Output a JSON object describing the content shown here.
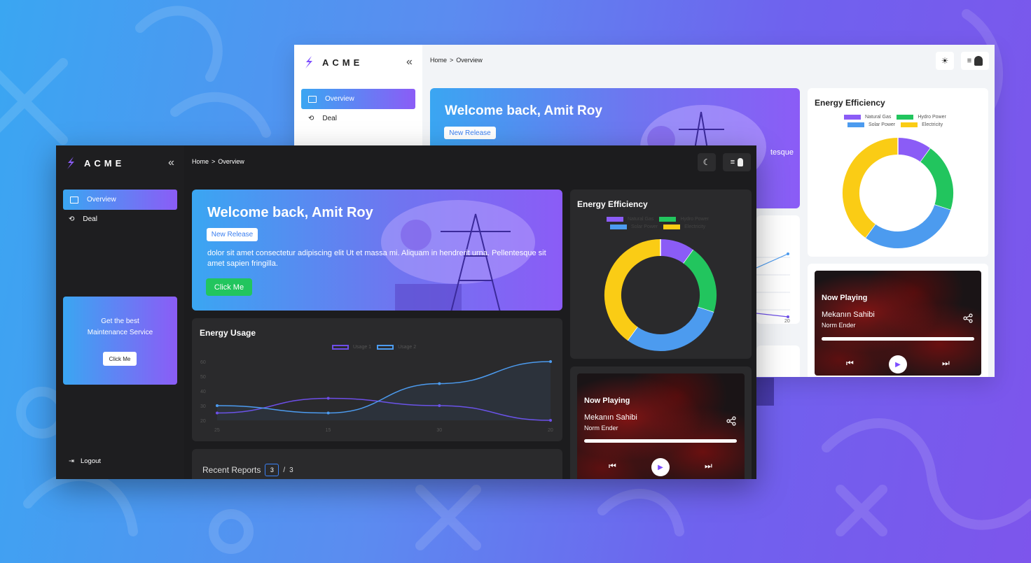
{
  "brand": {
    "name": "ACME"
  },
  "nav": {
    "items": [
      {
        "label": "Overview",
        "icon": "overview-icon",
        "active": true
      },
      {
        "label": "Deal",
        "icon": "deal-icon",
        "active": false
      }
    ],
    "collapse_glyph": "«",
    "logout_label": "Logout"
  },
  "breadcrumb": {
    "home": "Home",
    "separator": ">",
    "current": "Overview"
  },
  "hero": {
    "title": "Welcome back, Amit Roy",
    "badge": "New Release",
    "body": "dolor sit amet consectetur adipiscing elit Ut et massa mi. Aliquam in hendrerit urna. Pellentesque sit amet sapien fringilla.",
    "cta": "Click Me",
    "partial_text_light": "tesque"
  },
  "promo": {
    "line1": "Get the best",
    "line2": "Maintenance Service",
    "cta": "Click Me"
  },
  "energy_efficiency": {
    "title": "Energy Efficiency",
    "legend": [
      {
        "label": "Natural Gas",
        "color": "#8b5cf6"
      },
      {
        "label": "Hydro Power",
        "color": "#22c55e"
      },
      {
        "label": "Solar Power",
        "color": "#4c9bef"
      },
      {
        "label": "Electricity",
        "color": "#facc15"
      }
    ]
  },
  "energy_usage": {
    "title": "Energy Usage",
    "legend": [
      {
        "label": "Usage 1",
        "color": "#6d4ee8"
      },
      {
        "label": "Usage 2",
        "color": "#4c9bef"
      }
    ],
    "y_ticks": [
      "60",
      "50",
      "40",
      "30",
      "20"
    ],
    "x_ticks": [
      "25",
      "15",
      "30",
      "20"
    ]
  },
  "player": {
    "label": "Now Playing",
    "song": "Mekanın Sahibi",
    "artist": "Norm Ender"
  },
  "reports": {
    "title": "Recent Reports",
    "page": "3",
    "separator": "/",
    "total": "3"
  },
  "light_chart": {
    "x_tick": "20"
  },
  "chart_data": [
    {
      "type": "pie",
      "title": "Energy Efficiency",
      "categories": [
        "Natural Gas",
        "Hydro Power",
        "Solar Power",
        "Electricity"
      ],
      "values": [
        10,
        20,
        30,
        40
      ],
      "colors": [
        "#8b5cf6",
        "#22c55e",
        "#4c9bef",
        "#facc15"
      ],
      "legend": "top"
    },
    {
      "type": "line",
      "title": "Energy Usage",
      "categories": [
        "25",
        "15",
        "30",
        "20"
      ],
      "series": [
        {
          "name": "Usage 1",
          "values": [
            25,
            35,
            30,
            20
          ]
        },
        {
          "name": "Usage 2",
          "values": [
            30,
            25,
            45,
            60
          ]
        }
      ],
      "ylim": [
        20,
        60
      ],
      "legend": "top"
    }
  ]
}
